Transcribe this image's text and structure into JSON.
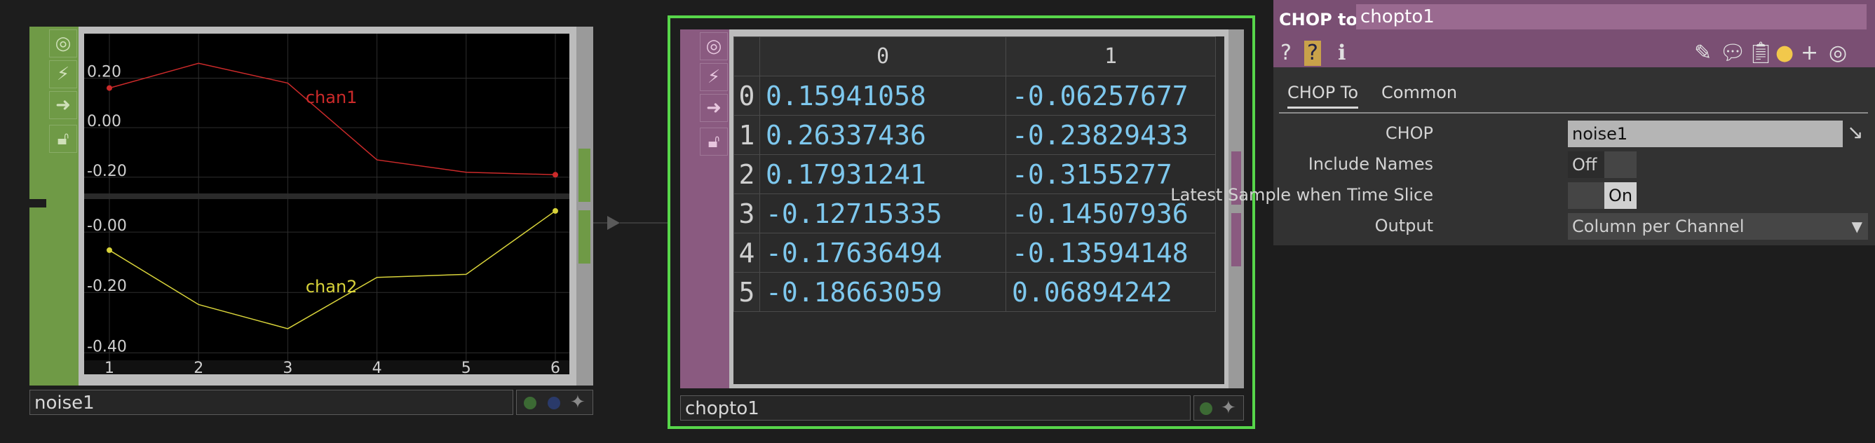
{
  "noise_node": {
    "name": "noise1",
    "chart_data": {
      "type": "line",
      "x": [
        1,
        2,
        3,
        4,
        5,
        6
      ],
      "xticks": [
        "1",
        "2",
        "3",
        "4",
        "5",
        "6"
      ],
      "series": [
        {
          "name": "chan1",
          "color": "#cc2a2a",
          "values": [
            0.16,
            0.26,
            0.18,
            -0.13,
            -0.18,
            -0.19
          ],
          "yticks": [
            "0.20",
            "0.00",
            "-0.20"
          ]
        },
        {
          "name": "chan2",
          "color": "#d8d33a",
          "values": [
            -0.06,
            -0.24,
            -0.32,
            -0.15,
            -0.14,
            0.07
          ],
          "yticks": [
            "-0.00",
            "-0.20",
            "-0.40"
          ]
        }
      ]
    }
  },
  "chopto_node": {
    "name": "chopto1",
    "columns": [
      "0",
      "1"
    ],
    "rows": [
      {
        "index": "0",
        "c0": "0.15941058",
        "c1": "-0.06257677"
      },
      {
        "index": "1",
        "c0": "0.26337436",
        "c1": "-0.23829433"
      },
      {
        "index": "2",
        "c0": "0.17931241",
        "c1": "-0.3155277"
      },
      {
        "index": "3",
        "c0": "-0.12715335",
        "c1": "-0.14507936"
      },
      {
        "index": "4",
        "c0": "-0.17636494",
        "c1": "-0.13594148"
      },
      {
        "index": "5",
        "c0": "-0.18663059",
        "c1": "0.06894242"
      }
    ]
  },
  "param_panel": {
    "op_type": "CHOP to",
    "op_name": "chopto1",
    "tabs": [
      "CHOP To",
      "Common"
    ],
    "params": {
      "chop_label": "CHOP",
      "chop_value": "noise1",
      "include_names_label": "Include Names",
      "include_names_value": "Off",
      "latest_sample_label": "Latest Sample when Time Slice",
      "latest_sample_value": "On",
      "output_label": "Output",
      "output_value": "Column per Channel"
    }
  }
}
